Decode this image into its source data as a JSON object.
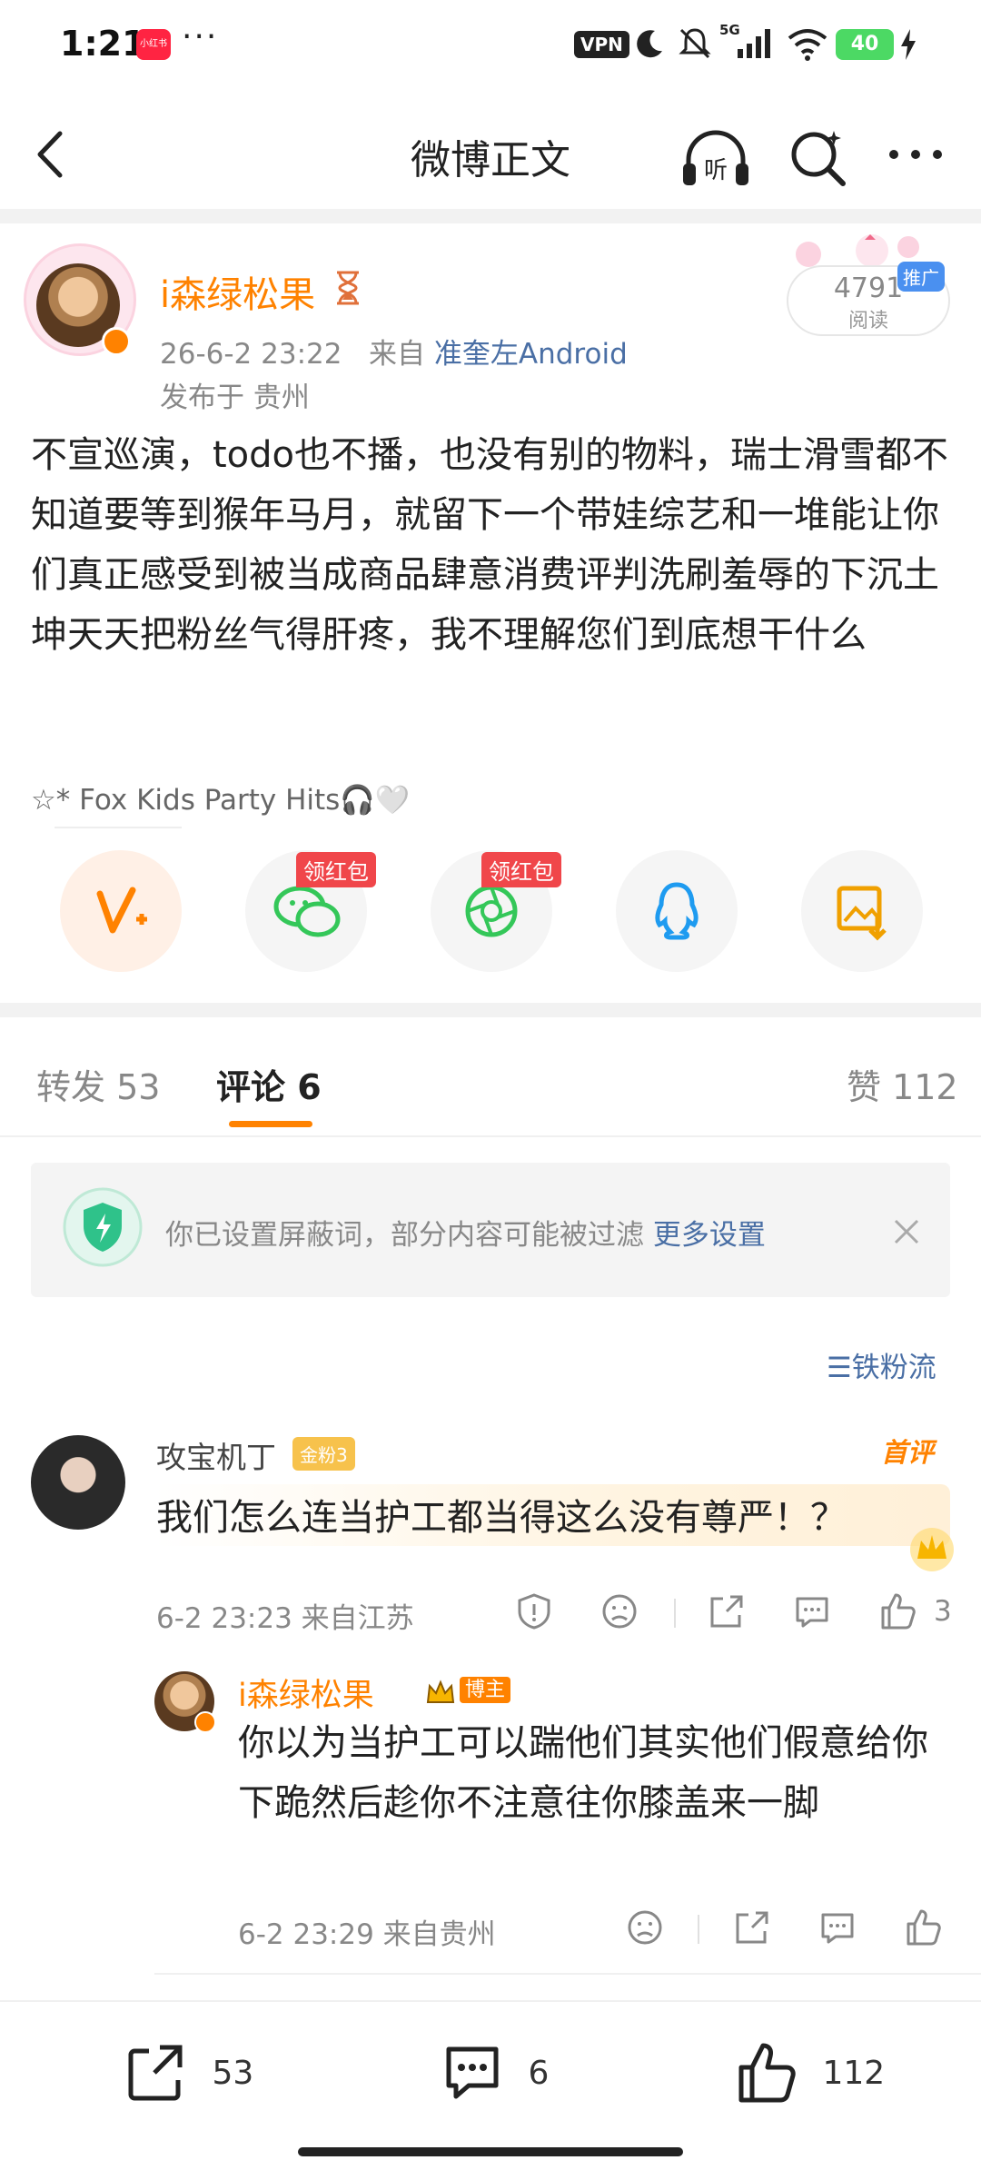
{
  "status_bar": {
    "time": "1:21",
    "app_icon_text": "小红书",
    "dots": "···",
    "vpn": "VPN",
    "signal_type": "5G",
    "battery": "40"
  },
  "header": {
    "title": "微博正文",
    "listen_label": "听"
  },
  "post": {
    "author": "i森绿松果",
    "time": "26-6-2 23:22",
    "source_prefix": "来自",
    "source": "准奎左Android",
    "location": "发布于 贵州",
    "read_count": "4791",
    "read_label": "阅读",
    "promo_tag": "推广",
    "text": "不宣巡演，todo也不播，也没有别的物料，瑞士滑雪都不知道要等到猴年马月，就留下一个带娃综艺和一堆能让你们真正感受到被当成商品肆意消费评判洗刷羞辱的下沉土坤天天把粉丝气得肝疼，我不理解您们到底想干什么",
    "music": "☆* Fox Kids Party Hits🎧🤍"
  },
  "share": {
    "red_packet_label": "领红包",
    "targets": [
      "vplus-icon",
      "wechat-icon",
      "moments-icon",
      "qq-icon",
      "save-image-icon"
    ]
  },
  "tabs": {
    "repost": "转发 53",
    "comments": "评论 6",
    "likes": "赞 112"
  },
  "notice": {
    "text": "你已设置屏蔽词，部分内容可能被过滤",
    "link": "更多设置"
  },
  "sort_label": "铁粉流",
  "comment": {
    "user": "攻宝机丁",
    "fan_badge": "金粉3",
    "first_tag": "首评",
    "text": "我们怎么连当护工都当得这么没有尊严！？",
    "meta": "6-2 23:23  来自江苏",
    "like_count": "3"
  },
  "reply": {
    "user": "i森绿松果",
    "role_tag": "博主",
    "text": "你以为当护工可以踹他们其实他们假意给你下跪然后趁你不注意往你膝盖来一脚",
    "meta": "6-2 23:29  来自贵州"
  },
  "bottom_bar": {
    "repost_count": "53",
    "comment_count": "6",
    "like_count": "112"
  },
  "colors": {
    "accent": "#ff8200",
    "link": "#4a6fa5",
    "muted": "#888888",
    "red_tag": "#f0464a"
  }
}
